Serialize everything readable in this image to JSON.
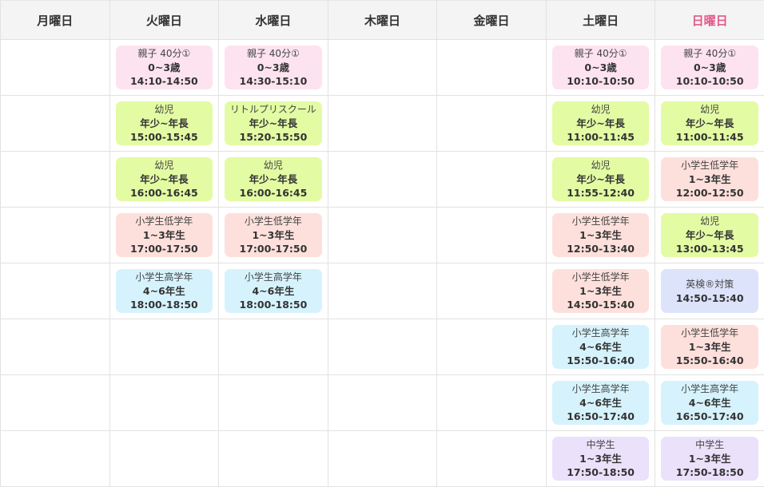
{
  "days": [
    {
      "label": "月曜日",
      "key": "mon"
    },
    {
      "label": "火曜日",
      "key": "tue"
    },
    {
      "label": "水曜日",
      "key": "wed"
    },
    {
      "label": "木曜日",
      "key": "thu"
    },
    {
      "label": "金曜日",
      "key": "fri"
    },
    {
      "label": "土曜日",
      "key": "sat"
    },
    {
      "label": "日曜日",
      "key": "sun"
    }
  ],
  "colors": {
    "header_bg": "#f4f4f4",
    "sunday_text": "#e05a8a",
    "pink": "#fde3ef",
    "green": "#e3fba3",
    "salmon": "#fde0dc",
    "blue": "#d6f3fd",
    "purple": "#ebe1fb",
    "lavender": "#dde3fb"
  },
  "slots": [
    [
      null,
      {
        "name": "親子 40分①",
        "age": "0~3歳",
        "time": "14:10-14:50",
        "color": "pink"
      },
      {
        "name": "親子 40分①",
        "age": "0~3歳",
        "time": "14:30-15:10",
        "color": "pink"
      },
      null,
      null,
      {
        "name": "親子 40分①",
        "age": "0~3歳",
        "time": "10:10-10:50",
        "color": "pink"
      },
      {
        "name": "親子 40分①",
        "age": "0~3歳",
        "time": "10:10-10:50",
        "color": "pink"
      }
    ],
    [
      null,
      {
        "name": "幼児",
        "age": "年少~年長",
        "time": "15:00-15:45",
        "color": "green"
      },
      {
        "name": "リトルプリスクール",
        "age": "年少~年長",
        "time": "15:20-15:50",
        "color": "green"
      },
      null,
      null,
      {
        "name": "幼児",
        "age": "年少~年長",
        "time": "11:00-11:45",
        "color": "green"
      },
      {
        "name": "幼児",
        "age": "年少~年長",
        "time": "11:00-11:45",
        "color": "green"
      }
    ],
    [
      null,
      {
        "name": "幼児",
        "age": "年少~年長",
        "time": "16:00-16:45",
        "color": "green"
      },
      {
        "name": "幼児",
        "age": "年少~年長",
        "time": "16:00-16:45",
        "color": "green"
      },
      null,
      null,
      {
        "name": "幼児",
        "age": "年少~年長",
        "time": "11:55-12:40",
        "color": "green"
      },
      {
        "name": "小学生低学年",
        "age": "1~3年生",
        "time": "12:00-12:50",
        "color": "salmon"
      }
    ],
    [
      null,
      {
        "name": "小学生低学年",
        "age": "1~3年生",
        "time": "17:00-17:50",
        "color": "salmon"
      },
      {
        "name": "小学生低学年",
        "age": "1~3年生",
        "time": "17:00-17:50",
        "color": "salmon"
      },
      null,
      null,
      {
        "name": "小学生低学年",
        "age": "1~3年生",
        "time": "12:50-13:40",
        "color": "salmon"
      },
      {
        "name": "幼児",
        "age": "年少~年長",
        "time": "13:00-13:45",
        "color": "green"
      }
    ],
    [
      null,
      {
        "name": "小学生高学年",
        "age": "4~6年生",
        "time": "18:00-18:50",
        "color": "blue"
      },
      {
        "name": "小学生高学年",
        "age": "4~6年生",
        "time": "18:00-18:50",
        "color": "blue"
      },
      null,
      null,
      {
        "name": "小学生低学年",
        "age": "1~3年生",
        "time": "14:50-15:40",
        "color": "salmon"
      },
      {
        "name": "英検®対策",
        "age": "",
        "time": "14:50-15:40",
        "color": "lavender"
      }
    ],
    [
      null,
      null,
      null,
      null,
      null,
      {
        "name": "小学生高学年",
        "age": "4~6年生",
        "time": "15:50-16:40",
        "color": "blue"
      },
      {
        "name": "小学生低学年",
        "age": "1~3年生",
        "time": "15:50-16:40",
        "color": "salmon"
      }
    ],
    [
      null,
      null,
      null,
      null,
      null,
      {
        "name": "小学生高学年",
        "age": "4~6年生",
        "time": "16:50-17:40",
        "color": "blue"
      },
      {
        "name": "小学生高学年",
        "age": "4~6年生",
        "time": "16:50-17:40",
        "color": "blue"
      }
    ],
    [
      null,
      null,
      null,
      null,
      null,
      {
        "name": "中学生",
        "age": "1~3年生",
        "time": "17:50-18:50",
        "color": "purple"
      },
      {
        "name": "中学生",
        "age": "1~3年生",
        "time": "17:50-18:50",
        "color": "purple"
      }
    ]
  ]
}
